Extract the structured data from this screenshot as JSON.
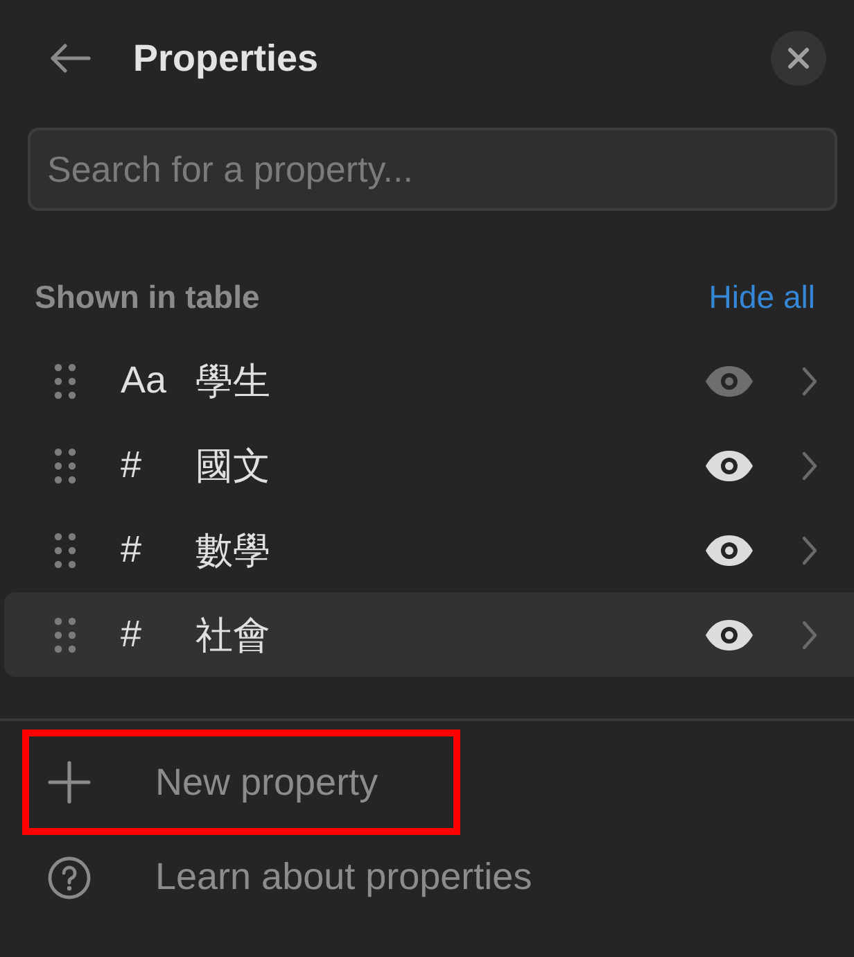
{
  "header": {
    "title": "Properties"
  },
  "search": {
    "placeholder": "Search for a property..."
  },
  "section": {
    "label": "Shown in table",
    "action": "Hide all"
  },
  "properties": [
    {
      "type_label": "Aa",
      "name": "學生",
      "eye_disabled": true,
      "selected": false
    },
    {
      "type_label": "#",
      "name": "國文",
      "eye_disabled": false,
      "selected": false
    },
    {
      "type_label": "#",
      "name": "數學",
      "eye_disabled": false,
      "selected": false
    },
    {
      "type_label": "#",
      "name": "社會",
      "eye_disabled": false,
      "selected": true
    }
  ],
  "footer": [
    {
      "kind": "add",
      "label": "New property",
      "highlighted": true
    },
    {
      "kind": "help",
      "label": "Learn about properties",
      "highlighted": false
    }
  ]
}
